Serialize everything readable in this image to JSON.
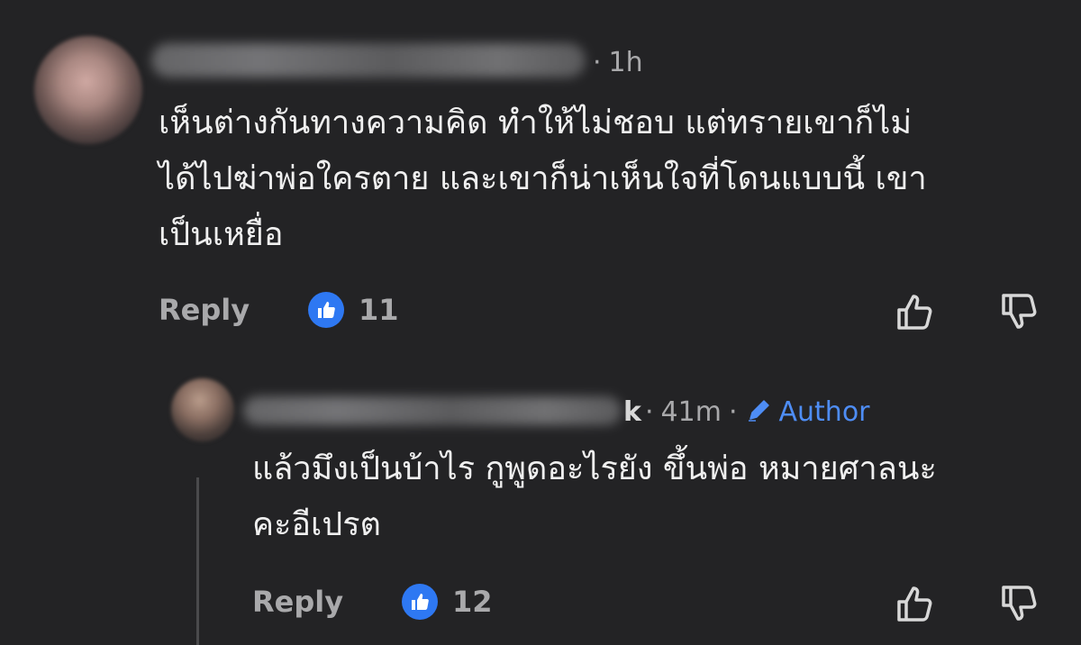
{
  "comments": [
    {
      "time": "1h",
      "text_lines": [
        "เห็นต่างกันทางความคิด ทำให้ไม่ชอบ แต่ทรายเขาก็ไม่",
        "ได้ไปฆ่าพ่อใครตาย และเขาก็น่าเห็นใจที่โดนแบบนี้ เขา",
        "เป็นเหยื่อ"
      ],
      "reply_label": "Reply",
      "like_count": "11"
    },
    {
      "name_visible_fragment": "k",
      "time": "41m",
      "badge": "Author",
      "text_lines": [
        "แล้วมึงเป็นบ้าไร กูพูดอะไรยัง ขึ้นพ่อ หมายศาลนะ",
        "คะอีเปรต"
      ],
      "reply_label": "Reply",
      "like_count": "12"
    }
  ],
  "colors": {
    "background": "#232325",
    "text": "#efefef",
    "muted": "#a9a9ab",
    "accent": "#2e78f2",
    "author": "#4e8df5"
  },
  "icons": [
    "like-reaction-icon",
    "thumbs-up-icon",
    "thumbs-down-icon",
    "pencil-icon"
  ]
}
